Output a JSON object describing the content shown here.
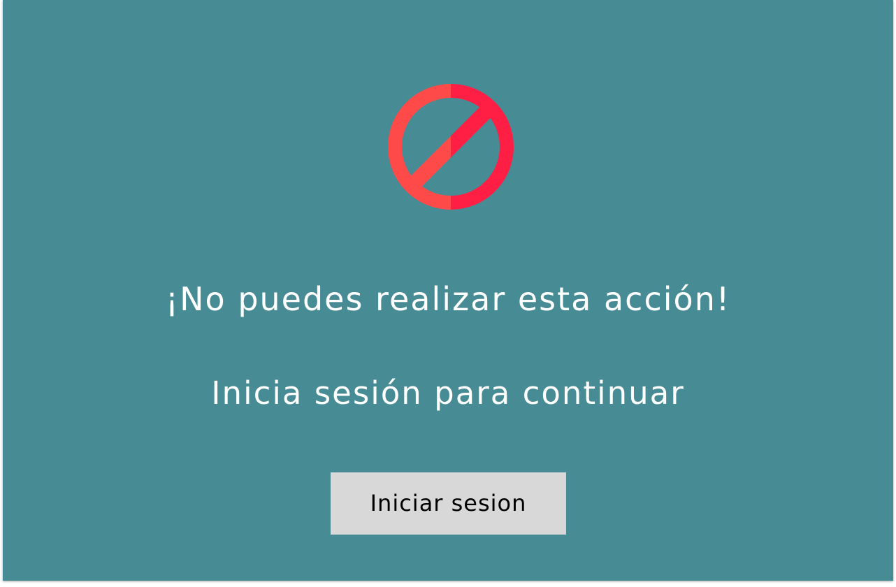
{
  "message": {
    "title": "¡No puedes realizar esta acción!",
    "subtitle": "Inicia sesión para continuar"
  },
  "actions": {
    "login_label": "Iniciar sesion"
  },
  "icon": {
    "name": "prohibited-icon",
    "color_left": "#ff4a4a",
    "color_right": "#ff1f45"
  },
  "colors": {
    "background": "#478b94",
    "button": "#d9d8d8",
    "text": "#ffffff",
    "button_text": "#000000"
  }
}
